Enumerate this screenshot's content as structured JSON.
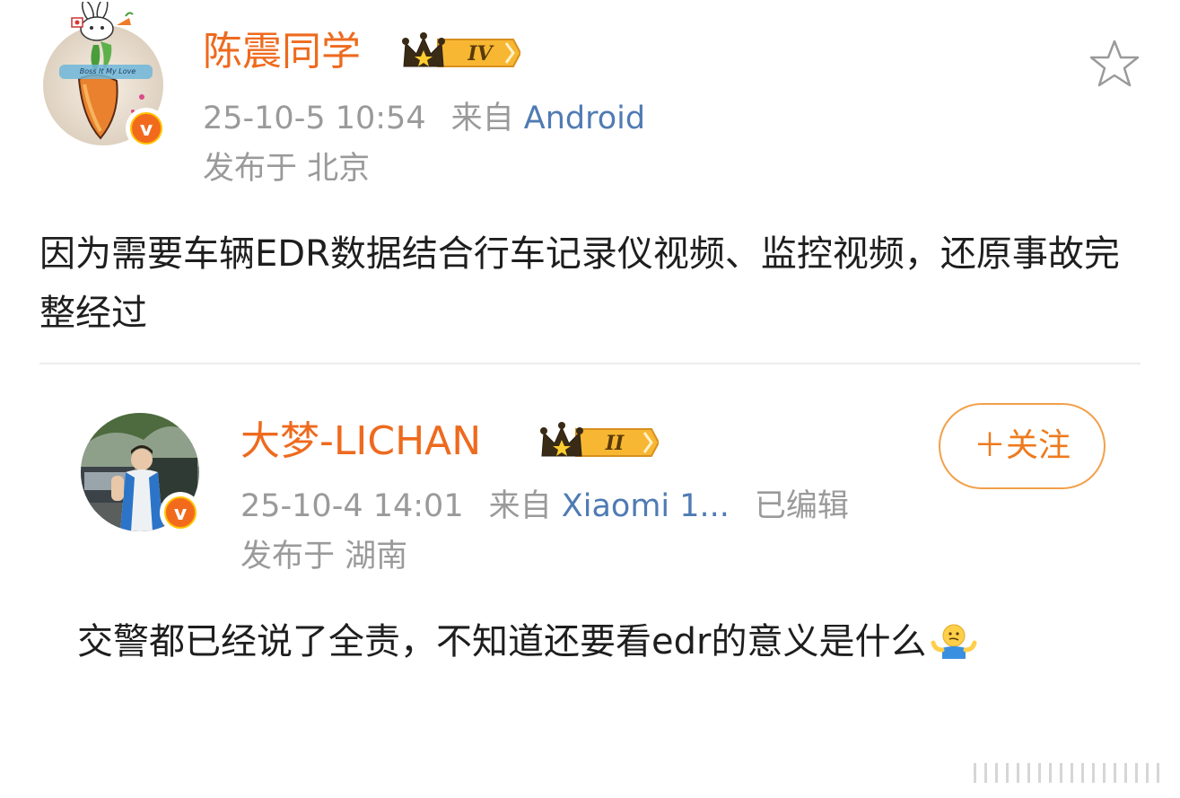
{
  "post": {
    "author": "陈震同学",
    "level": "IV",
    "timestamp": "25-10-5 10:54",
    "source_prefix": "来自",
    "source": "Android",
    "location": "发布于 北京",
    "text": "因为需要车辆EDR数据结合行车记录仪视频、监控视频，还原事故完整经过",
    "avatar_caption": "Boss It My Love"
  },
  "quoted": {
    "author": "大梦-LICHAN",
    "level": "II",
    "timestamp": "25-10-4 14:01",
    "source_prefix": "来自",
    "source": "Xiaomi 1...",
    "edited": "已编辑",
    "location": "发布于 湖南",
    "follow_label": "＋关注",
    "text": "交警都已经说了全责，不知道还要看edr的意义是什么"
  },
  "icons": {
    "verified": "v-verified-badge",
    "favorite": "star-outline-icon",
    "emoji": "shrug-emoji"
  },
  "colors": {
    "name": "#ee6a1e",
    "meta": "#9a9a9a",
    "source_link": "#4f7bb3",
    "follow_border": "#f2a04a"
  }
}
